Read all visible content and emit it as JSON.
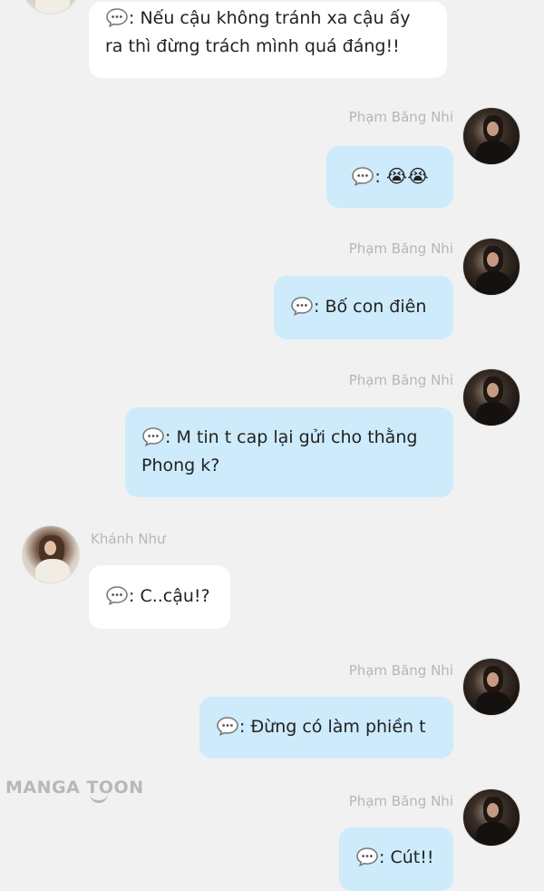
{
  "messages": [
    {
      "side": "left",
      "sender": "",
      "lines": [
        "Nếu cậu không tránh xa cậu ấy",
        "ra thì đừng trách mình quá đáng!!"
      ]
    },
    {
      "side": "right",
      "sender": "Phạm Băng Nhi",
      "lines": [
        ""
      ],
      "emoji": [
        "😭",
        "😭"
      ]
    },
    {
      "side": "right",
      "sender": "Phạm Băng Nhi",
      "lines": [
        "Bố con điên"
      ]
    },
    {
      "side": "right",
      "sender": "Phạm Băng Nhi",
      "lines": [
        "M tin t cap lại gửi cho thằng",
        "Phong k?"
      ]
    },
    {
      "side": "left",
      "sender": "Khánh Như",
      "lines": [
        "C..cậu!?"
      ]
    },
    {
      "side": "right",
      "sender": "Phạm Băng Nhi",
      "lines": [
        "Đừng có làm phiền t"
      ]
    },
    {
      "side": "right",
      "sender": "Phạm Băng Nhi",
      "lines": [
        "Cút!!"
      ]
    }
  ],
  "watermark": "MANGA TOON",
  "colors": {
    "background": "#f1f1f1",
    "left_bubble": "#ffffff",
    "right_bubble": "#cdebfb",
    "name_text": "#b6b6b6"
  }
}
